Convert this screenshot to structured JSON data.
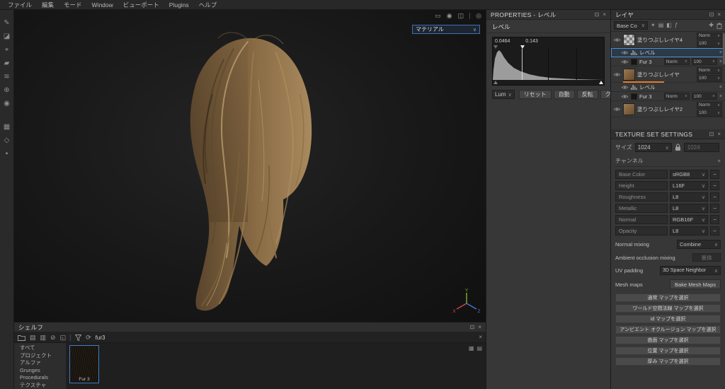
{
  "icons": {
    "close": "×",
    "dock": "⊡",
    "chevron": "∨",
    "plus": "+",
    "minus": "−",
    "refresh": "⟳",
    "grid_view": "▦",
    "list_view": "▤",
    "wand": "✶",
    "stack": "▤",
    "bucket": "◧",
    "fx": "ƒ",
    "add_folder": "✚",
    "doc_a": "▤",
    "doc_b": "▥",
    "doc_c": "⊘",
    "doc_d": "◱"
  },
  "menubar": {
    "items": [
      "ファイル",
      "編集",
      "モード",
      "Window",
      "ビューポート",
      "Plugins",
      "ヘルプ"
    ]
  },
  "toolbar": {
    "tool_icons": [
      "✎",
      "◪",
      "⌖",
      "▰",
      "≋",
      "⊕",
      "◉",
      "▦",
      "◇",
      "▪"
    ]
  },
  "viewport": {
    "material_dropdown": "マテリアル",
    "top_icons": [
      "▭",
      "◉",
      "◫",
      "◎"
    ],
    "axis": {
      "x": "X",
      "y": "Y",
      "z": "Z"
    }
  },
  "properties": {
    "title": "PROPERTIES  -  レベル",
    "section": "レベル",
    "histogram": {
      "left_value": "0.0464",
      "marker_value": "0.143"
    },
    "channel_value": "Lum",
    "buttons": {
      "reset": "リセット",
      "auto": "自動",
      "invert": "反転",
      "clamp": "クランプ"
    }
  },
  "layers": {
    "title": "レイヤ",
    "filter_value": "Base Co",
    "rows": [
      {
        "name": "塗りつぶしレイヤ4",
        "blend": "Norm",
        "opacity": "100"
      },
      {
        "name": "レベル"
      },
      {
        "name": "Fur 3",
        "blend": "Norm",
        "opacity": "100"
      },
      {
        "name": "塗りつぶしレイヤ",
        "blend": "Norm",
        "opacity": "100"
      },
      {
        "name": "レベル"
      },
      {
        "name": "Fur 3",
        "blend": "Norm",
        "opacity": "100"
      },
      {
        "name": "塗りつぶしレイヤ2",
        "blend": "Norm",
        "opacity": "100"
      }
    ]
  },
  "texture_set": {
    "title": "TEXTURE SET SETTINGS",
    "size_label": "サイズ",
    "size_value": "1024",
    "size_locked": "1024",
    "channels_label": "チャンネル",
    "channels": [
      {
        "name": "Base Color",
        "format": "sRGB8"
      },
      {
        "name": "Height",
        "format": "L16F"
      },
      {
        "name": "Roughness",
        "format": "L8"
      },
      {
        "name": "Metallic",
        "format": "L8"
      },
      {
        "name": "Normal",
        "format": "RGB16F"
      },
      {
        "name": "Opacity",
        "format": "L8"
      }
    ],
    "normal_mixing_label": "Normal mixing",
    "normal_mixing_value": "Combine",
    "ao_mixing_label": "Ambient occlusion mixing",
    "ao_mixing_value": "置換",
    "uv_padding_label": "UV padding",
    "uv_padding_value": "3D Space Neighbor",
    "mesh_maps_label": "Mesh maps",
    "bake_button": "Bake Mesh Maps",
    "map_buttons": [
      "通常 マップを選択",
      "ワールド空間法線 マップを選択",
      "id マップを選択",
      "アンビエント オクルージョン マップを選択",
      "曲面 マップを選択",
      "位置 マップを選択",
      "厚み マップを選択"
    ]
  },
  "shelf": {
    "title": "シェルフ",
    "search_value": "fur3",
    "categories": [
      "すべて",
      "プロジェクト",
      "アルファ",
      "Grunges",
      "Procedurals",
      "テクスチャ"
    ],
    "item_label": "Fur 3"
  },
  "accent_colors": {
    "selection_blue": "#4c8fd6",
    "accent_orange": "#e07b2a"
  }
}
